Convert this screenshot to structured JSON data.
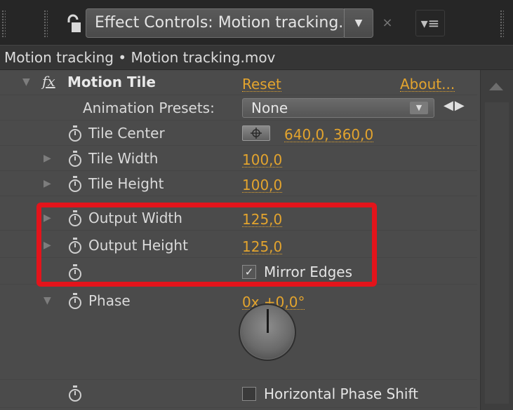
{
  "panel": {
    "tab_title": "Effect Controls: Motion tracking.mov",
    "dropdown_glyph": "▼",
    "close_glyph": "×",
    "menu_glyph": "▾≡",
    "breadcrumb": "Motion tracking • Motion tracking.mov"
  },
  "effect": {
    "fx_label": "fx",
    "name": "Motion Tile",
    "reset_label": "Reset",
    "about_label": "About..."
  },
  "presets": {
    "label": "Animation Presets:",
    "value": "None",
    "arrow_glyph": "▼",
    "nav_glyph": "◀▶"
  },
  "properties": {
    "tile_center": {
      "label": "Tile Center",
      "value": "640,0, 360,0"
    },
    "tile_width": {
      "label": "Tile Width",
      "value": "100,0"
    },
    "tile_height": {
      "label": "Tile Height",
      "value": "100,0"
    },
    "output_width": {
      "label": "Output Width",
      "value": "125,0"
    },
    "output_height": {
      "label": "Output Height",
      "value": "125,0"
    },
    "mirror_edges": {
      "label": "Mirror Edges",
      "checked": true,
      "check_glyph": "✓"
    },
    "phase": {
      "label": "Phase",
      "value": "0x +0,0°"
    },
    "horizontal_phase_shift": {
      "label": "Horizontal Phase Shift",
      "checked": false
    }
  },
  "icons": {
    "twirl_closed": "▶",
    "twirl_open": "▼"
  },
  "colors": {
    "value_orange": "#e3a42e",
    "highlight_red": "#e3141b",
    "panel_bg": "#4b4b4b"
  }
}
